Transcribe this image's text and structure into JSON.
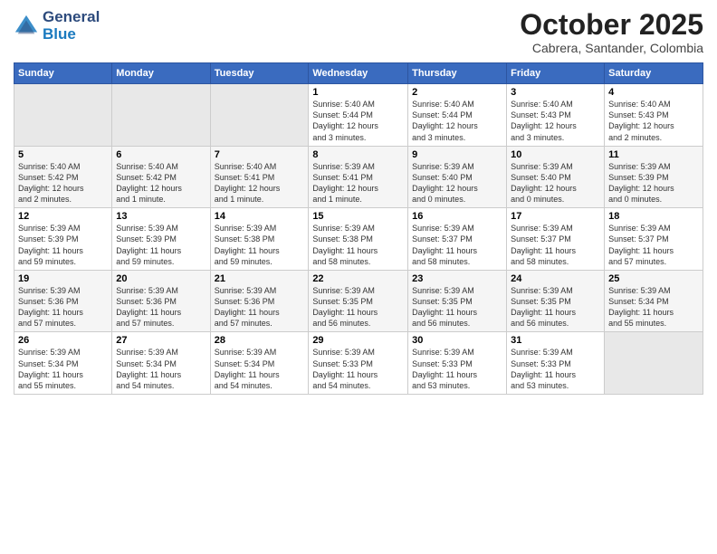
{
  "logo": {
    "text1": "General",
    "text2": "Blue"
  },
  "title": "October 2025",
  "subtitle": "Cabrera, Santander, Colombia",
  "days_of_week": [
    "Sunday",
    "Monday",
    "Tuesday",
    "Wednesday",
    "Thursday",
    "Friday",
    "Saturday"
  ],
  "weeks": [
    [
      {
        "day": "",
        "info": ""
      },
      {
        "day": "",
        "info": ""
      },
      {
        "day": "",
        "info": ""
      },
      {
        "day": "1",
        "info": "Sunrise: 5:40 AM\nSunset: 5:44 PM\nDaylight: 12 hours\nand 3 minutes."
      },
      {
        "day": "2",
        "info": "Sunrise: 5:40 AM\nSunset: 5:44 PM\nDaylight: 12 hours\nand 3 minutes."
      },
      {
        "day": "3",
        "info": "Sunrise: 5:40 AM\nSunset: 5:43 PM\nDaylight: 12 hours\nand 3 minutes."
      },
      {
        "day": "4",
        "info": "Sunrise: 5:40 AM\nSunset: 5:43 PM\nDaylight: 12 hours\nand 2 minutes."
      }
    ],
    [
      {
        "day": "5",
        "info": "Sunrise: 5:40 AM\nSunset: 5:42 PM\nDaylight: 12 hours\nand 2 minutes."
      },
      {
        "day": "6",
        "info": "Sunrise: 5:40 AM\nSunset: 5:42 PM\nDaylight: 12 hours\nand 1 minute."
      },
      {
        "day": "7",
        "info": "Sunrise: 5:40 AM\nSunset: 5:41 PM\nDaylight: 12 hours\nand 1 minute."
      },
      {
        "day": "8",
        "info": "Sunrise: 5:39 AM\nSunset: 5:41 PM\nDaylight: 12 hours\nand 1 minute."
      },
      {
        "day": "9",
        "info": "Sunrise: 5:39 AM\nSunset: 5:40 PM\nDaylight: 12 hours\nand 0 minutes."
      },
      {
        "day": "10",
        "info": "Sunrise: 5:39 AM\nSunset: 5:40 PM\nDaylight: 12 hours\nand 0 minutes."
      },
      {
        "day": "11",
        "info": "Sunrise: 5:39 AM\nSunset: 5:39 PM\nDaylight: 12 hours\nand 0 minutes."
      }
    ],
    [
      {
        "day": "12",
        "info": "Sunrise: 5:39 AM\nSunset: 5:39 PM\nDaylight: 11 hours\nand 59 minutes."
      },
      {
        "day": "13",
        "info": "Sunrise: 5:39 AM\nSunset: 5:39 PM\nDaylight: 11 hours\nand 59 minutes."
      },
      {
        "day": "14",
        "info": "Sunrise: 5:39 AM\nSunset: 5:38 PM\nDaylight: 11 hours\nand 59 minutes."
      },
      {
        "day": "15",
        "info": "Sunrise: 5:39 AM\nSunset: 5:38 PM\nDaylight: 11 hours\nand 58 minutes."
      },
      {
        "day": "16",
        "info": "Sunrise: 5:39 AM\nSunset: 5:37 PM\nDaylight: 11 hours\nand 58 minutes."
      },
      {
        "day": "17",
        "info": "Sunrise: 5:39 AM\nSunset: 5:37 PM\nDaylight: 11 hours\nand 58 minutes."
      },
      {
        "day": "18",
        "info": "Sunrise: 5:39 AM\nSunset: 5:37 PM\nDaylight: 11 hours\nand 57 minutes."
      }
    ],
    [
      {
        "day": "19",
        "info": "Sunrise: 5:39 AM\nSunset: 5:36 PM\nDaylight: 11 hours\nand 57 minutes."
      },
      {
        "day": "20",
        "info": "Sunrise: 5:39 AM\nSunset: 5:36 PM\nDaylight: 11 hours\nand 57 minutes."
      },
      {
        "day": "21",
        "info": "Sunrise: 5:39 AM\nSunset: 5:36 PM\nDaylight: 11 hours\nand 57 minutes."
      },
      {
        "day": "22",
        "info": "Sunrise: 5:39 AM\nSunset: 5:35 PM\nDaylight: 11 hours\nand 56 minutes."
      },
      {
        "day": "23",
        "info": "Sunrise: 5:39 AM\nSunset: 5:35 PM\nDaylight: 11 hours\nand 56 minutes."
      },
      {
        "day": "24",
        "info": "Sunrise: 5:39 AM\nSunset: 5:35 PM\nDaylight: 11 hours\nand 56 minutes."
      },
      {
        "day": "25",
        "info": "Sunrise: 5:39 AM\nSunset: 5:34 PM\nDaylight: 11 hours\nand 55 minutes."
      }
    ],
    [
      {
        "day": "26",
        "info": "Sunrise: 5:39 AM\nSunset: 5:34 PM\nDaylight: 11 hours\nand 55 minutes."
      },
      {
        "day": "27",
        "info": "Sunrise: 5:39 AM\nSunset: 5:34 PM\nDaylight: 11 hours\nand 54 minutes."
      },
      {
        "day": "28",
        "info": "Sunrise: 5:39 AM\nSunset: 5:34 PM\nDaylight: 11 hours\nand 54 minutes."
      },
      {
        "day": "29",
        "info": "Sunrise: 5:39 AM\nSunset: 5:33 PM\nDaylight: 11 hours\nand 54 minutes."
      },
      {
        "day": "30",
        "info": "Sunrise: 5:39 AM\nSunset: 5:33 PM\nDaylight: 11 hours\nand 53 minutes."
      },
      {
        "day": "31",
        "info": "Sunrise: 5:39 AM\nSunset: 5:33 PM\nDaylight: 11 hours\nand 53 minutes."
      },
      {
        "day": "",
        "info": ""
      }
    ]
  ]
}
